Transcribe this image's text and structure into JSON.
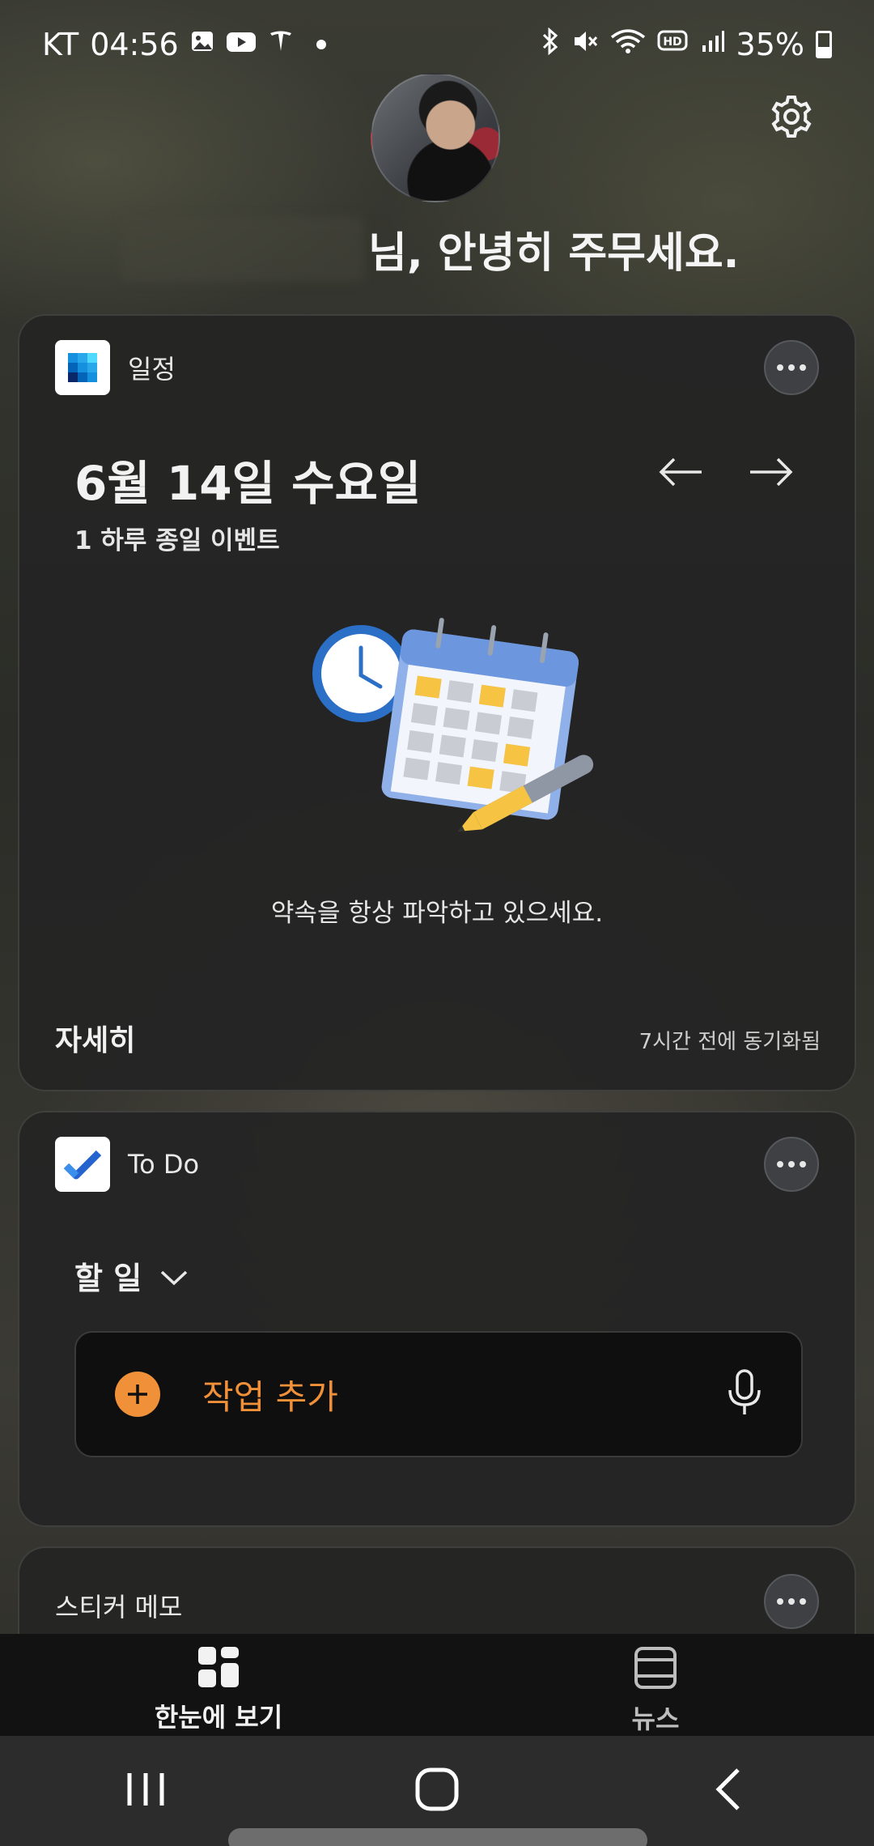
{
  "status_bar": {
    "carrier": "KT",
    "time": "04:56",
    "battery": "35%",
    "icons": [
      "gallery-icon",
      "youtube-icon",
      "tesla-icon",
      "bluetooth-icon",
      "mute-icon",
      "wifi-icon",
      "hd-icon",
      "signal-icon",
      "battery-icon"
    ]
  },
  "header": {
    "greeting": "님, 안녕히 주무세요."
  },
  "calendar_card": {
    "title": "일정",
    "date": "6월 14일 수요일",
    "subtitle": "1 하루 종일 이벤트",
    "empty_message": "약속을 항상 파악하고 있으세요.",
    "more_link": "자세히",
    "sync_status": "7시간 전에 동기화됨"
  },
  "todo_card": {
    "title": "To Do",
    "list_name": "할 일",
    "add_task_label": "작업 추가"
  },
  "sticky_card": {
    "title": "스티커 메모"
  },
  "bottom_tabs": [
    {
      "label": "한눈에 보기",
      "active": true
    },
    {
      "label": "뉴스",
      "active": false
    }
  ],
  "colors": {
    "accent": "#f0913a",
    "card_bg": "#242424",
    "tab_bar_bg": "#121212",
    "nav_bar_bg": "#2c2c2c"
  }
}
